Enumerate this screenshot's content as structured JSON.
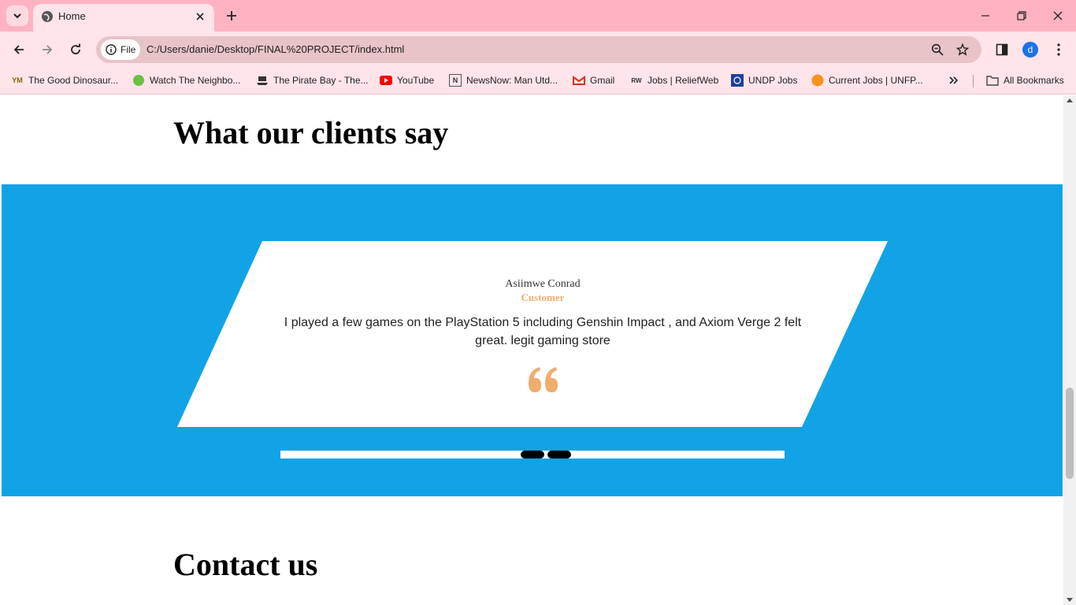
{
  "browser": {
    "tab_title": "Home",
    "url_chip": "File",
    "url": "C:/Users/danie/Desktop/FINAL%20PROJECT/index.html",
    "profile_initial": "d",
    "bookmarks": [
      {
        "label": "The Good Dinosaur...",
        "icon": "ym-icon"
      },
      {
        "label": "Watch The Neighbo...",
        "icon": "green-circle-icon"
      },
      {
        "label": "The Pirate Bay - The...",
        "icon": "pirate-ship-icon"
      },
      {
        "label": "YouTube",
        "icon": "youtube-icon"
      },
      {
        "label": "NewsNow: Man Utd...",
        "icon": "newsnow-icon"
      },
      {
        "label": "Gmail",
        "icon": "gmail-icon"
      },
      {
        "label": "Jobs | ReliefWeb",
        "icon": "reliefweb-icon"
      },
      {
        "label": "UNDP Jobs",
        "icon": "undp-icon"
      },
      {
        "label": "Current Jobs | UNFP...",
        "icon": "unfpa-icon"
      }
    ],
    "all_bookmarks": "All Bookmarks"
  },
  "page": {
    "clients_heading": "What our clients say",
    "testimonial": {
      "author": "Asiimwe Conrad",
      "role": "Customer",
      "text": "I played a few games on the PlayStation 5 including Genshin Impact , and Axiom Verge 2 felt great. legit gaming store"
    },
    "contact_heading": "Contact us"
  },
  "colors": {
    "tabbar": "#ffb3c1",
    "toolbar": "#ffe4ea",
    "band": "#12a3e6",
    "accent": "#f0ad6e"
  }
}
